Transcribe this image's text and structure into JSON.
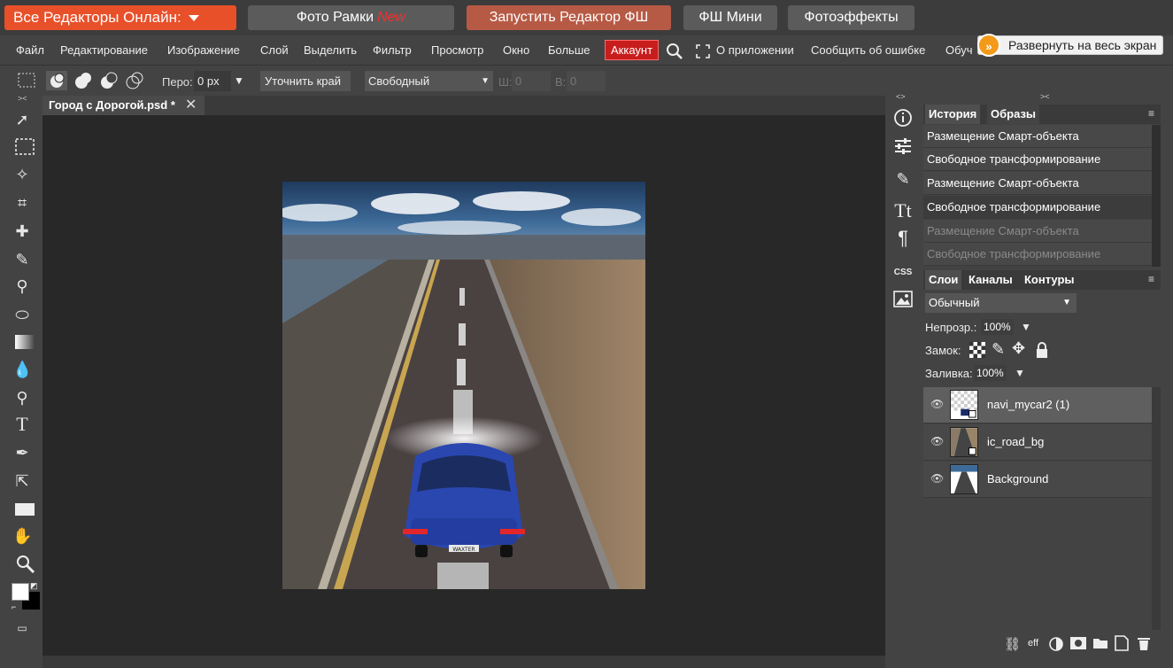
{
  "topbar": {
    "all_editors": "Все Редакторы Онлайн:",
    "photo_frames": "Фото Рамки",
    "new_badge": "New",
    "run_editor": "Запустить Редактор ФШ",
    "fs_mini": "ФШ Мини",
    "photo_effects": "Фотоэффекты"
  },
  "menu": {
    "file": "Файл",
    "edit": "Редактирование",
    "image": "Изображение",
    "layer": "Слой",
    "select": "Выделить",
    "filter": "Фильтр",
    "view": "Просмотр",
    "window": "Окно",
    "more": "Больше",
    "account": "Аккаунт",
    "about": "О приложении",
    "report": "Сообщить об ошибке",
    "learn": "Обуч"
  },
  "expand_tooltip": "Развернуть на весь экран",
  "options": {
    "feather_label": "Перо:",
    "feather_value": "0 px",
    "refine_edge": "Уточнить край",
    "mode": "Свободный",
    "w_label": "Ш:",
    "w_value": "0",
    "h_label": "В:",
    "h_value": "0"
  },
  "document": {
    "tab_title": "Город с Дорогой.psd *",
    "plate_text": "WAXTER"
  },
  "history_panel": {
    "tab_history": "История",
    "tab_samples": "Образы",
    "items": [
      {
        "label": "Размещение Смарт-объекта"
      },
      {
        "label": "Свободное трансформирование"
      },
      {
        "label": "Размещение Смарт-объекта"
      },
      {
        "label": "Свободное трансформирование"
      },
      {
        "label": "Размещение Смарт-объекта"
      },
      {
        "label": "Свободное трансформирование"
      }
    ]
  },
  "layers_panel": {
    "tab_layers": "Слои",
    "tab_channels": "Каналы",
    "tab_paths": "Контуры",
    "blend_mode": "Обычный",
    "opacity_label": "Непрозр.:",
    "opacity_value": "100%",
    "lock_label": "Замок:",
    "fill_label": "Заливка:",
    "fill_value": "100%",
    "layers": [
      {
        "name": "navi_mycar2 (1)"
      },
      {
        "name": "ic_road_bg"
      },
      {
        "name": "Background"
      }
    ],
    "footer_eff": "eff"
  },
  "right_icons": {
    "css": "CSS"
  },
  "colors": {
    "accent_orange": "#e8502a",
    "account_red": "#c81d1d",
    "panel_bg": "#434343",
    "canvas_bg": "#282828"
  }
}
